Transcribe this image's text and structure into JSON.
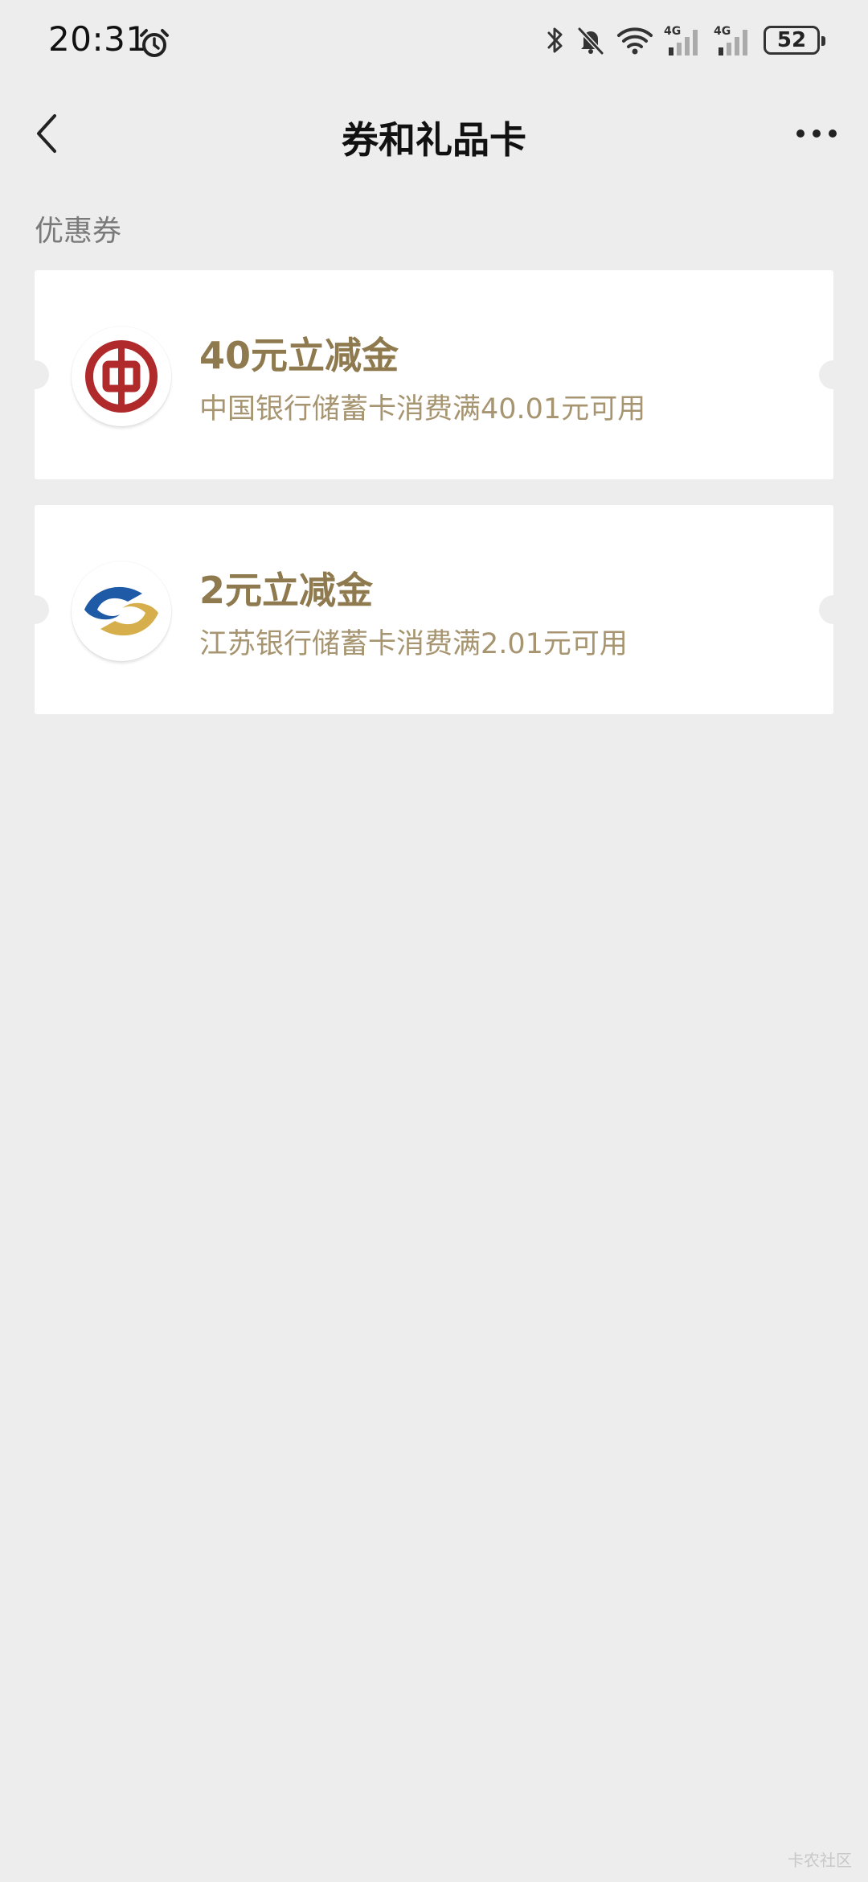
{
  "status_bar": {
    "time": "20:31",
    "battery": "52",
    "network_label_1": "4G",
    "network_label_2": "4G"
  },
  "nav": {
    "title": "券和礼品卡"
  },
  "section": {
    "label": "优惠券"
  },
  "coupons": [
    {
      "title": "40元立减金",
      "description": "中国银行储蓄卡消费满40.01元可用",
      "logo_icon": "bank-of-china-logo-icon"
    },
    {
      "title": "2元立减金",
      "description": "江苏银行储蓄卡消费满2.01元可用",
      "logo_icon": "bank-of-jiangsu-logo-icon"
    }
  ],
  "watermark": "卡农社区",
  "colors": {
    "background": "#ededed",
    "card": "#ffffff",
    "coupon_title": "#8e7a4e",
    "coupon_desc": "#a69570",
    "boc_red": "#b02a2c",
    "jsb_blue": "#1f5aa6",
    "jsb_gold": "#d7ae4c"
  }
}
